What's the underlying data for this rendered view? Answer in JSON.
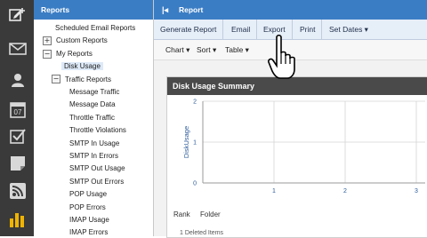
{
  "rail": {
    "items": [
      {
        "name": "compose-icon",
        "glyph": "✎+"
      },
      {
        "name": "mail-icon",
        "glyph": "✉"
      },
      {
        "name": "contacts-icon",
        "glyph": "●"
      },
      {
        "name": "calendar-icon",
        "glyph": "07"
      },
      {
        "name": "tasks-icon",
        "glyph": "☑"
      },
      {
        "name": "notes-icon",
        "glyph": "▪"
      },
      {
        "name": "rss-icon",
        "glyph": "))"
      },
      {
        "name": "reports-icon",
        "glyph": "▮▮▮"
      }
    ]
  },
  "tree": {
    "title": "Reports",
    "items": [
      {
        "label": "Scheduled Email Reports",
        "level": 1,
        "toggle": ""
      },
      {
        "label": "Custom Reports",
        "level": 1,
        "toggle": "+"
      },
      {
        "label": "My Reports",
        "level": 1,
        "toggle": "−"
      },
      {
        "label": "Disk Usage",
        "level": 2,
        "toggle": "",
        "selected": true
      },
      {
        "label": "Traffic Reports",
        "level": 2,
        "toggle": "−"
      },
      {
        "label": "Message Traffic",
        "level": 3,
        "toggle": ""
      },
      {
        "label": "Message Data",
        "level": 3,
        "toggle": ""
      },
      {
        "label": "Throttle Traffic",
        "level": 3,
        "toggle": ""
      },
      {
        "label": "Throttle Violations",
        "level": 3,
        "toggle": ""
      },
      {
        "label": "SMTP In Usage",
        "level": 3,
        "toggle": ""
      },
      {
        "label": "SMTP In Errors",
        "level": 3,
        "toggle": ""
      },
      {
        "label": "SMTP Out Usage",
        "level": 3,
        "toggle": ""
      },
      {
        "label": "SMTP Out Errors",
        "level": 3,
        "toggle": ""
      },
      {
        "label": "POP Usage",
        "level": 3,
        "toggle": ""
      },
      {
        "label": "POP Errors",
        "level": 3,
        "toggle": ""
      },
      {
        "label": "IMAP Usage",
        "level": 3,
        "toggle": ""
      },
      {
        "label": "IMAP Errors",
        "level": 3,
        "toggle": ""
      }
    ]
  },
  "main": {
    "title": "Report",
    "collapse_glyph": "|◂",
    "toolbar": {
      "generate": "Generate Report",
      "email": "Email",
      "export": "Export",
      "print": "Print",
      "set_dates": "Set Dates ▾"
    },
    "subtoolbar": {
      "chart": "Chart ▾",
      "sort": "Sort ▾",
      "table": "Table ▾"
    },
    "panel": {
      "title": "Disk Usage Summary",
      "columns": {
        "rank": "Rank",
        "folder": "Folder"
      },
      "first_row": "1        Deleted Items"
    }
  },
  "chart_data": {
    "type": "bar",
    "title": "Disk Usage Summary",
    "xlabel": "",
    "ylabel": "DiskUsage",
    "ylim": [
      0,
      2
    ],
    "xlim": [
      0,
      3
    ],
    "y_ticks": [
      "2",
      "1",
      "0"
    ],
    "x_ticks": [
      "1",
      "2",
      "3"
    ],
    "categories": [],
    "values": [],
    "grid": true
  },
  "colors": {
    "header_blue": "#3b7dc4",
    "rail_bg": "#3a3a3a",
    "panel_header": "#4a4a4a",
    "toolbar_bg": "#e6eef8"
  }
}
